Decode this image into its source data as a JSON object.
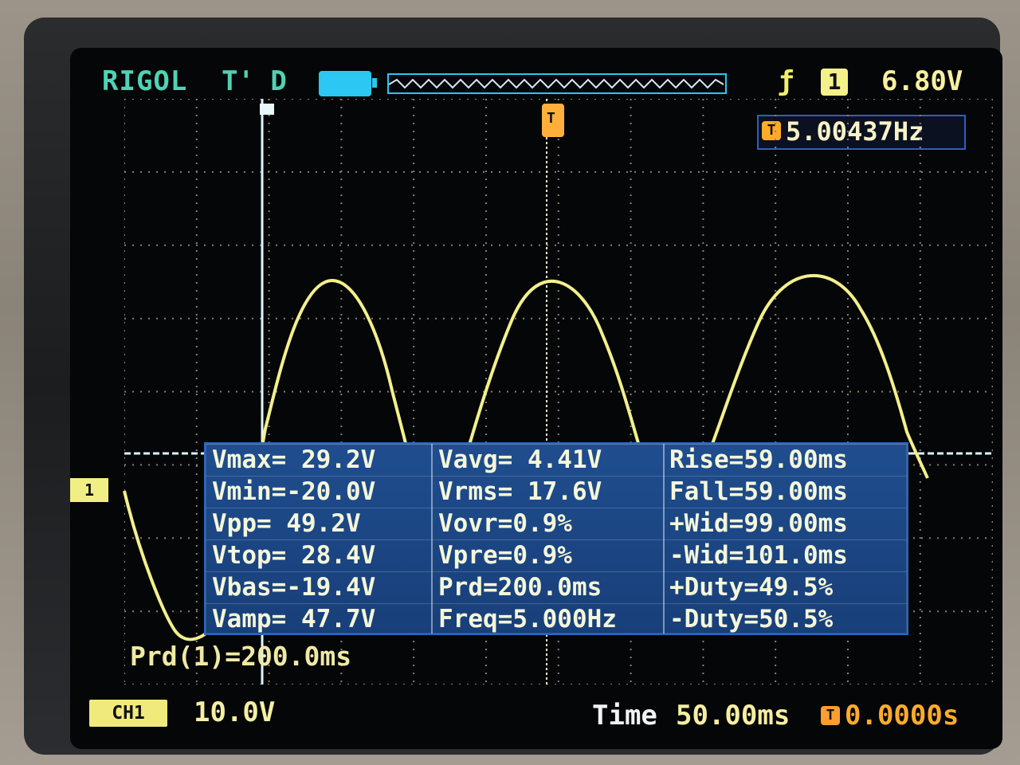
{
  "top_bar": {
    "brand": "RIGOL",
    "status": "T' D",
    "trigger_level": "6.80V",
    "channel": "1"
  },
  "frequency": {
    "value": "5.00437Hz"
  },
  "measurements": {
    "rows": [
      {
        "c1": "Vmax= 29.2V",
        "c2": "Vavg= 4.41V",
        "c3": "Rise=59.00ms"
      },
      {
        "c1": "Vmin=-20.0V",
        "c2": "Vrms= 17.6V",
        "c3": "Fall=59.00ms"
      },
      {
        "c1": "Vpp= 49.2V",
        "c2": "Vovr=0.9%",
        "c3": "+Wid=99.00ms"
      },
      {
        "c1": "Vtop= 28.4V",
        "c2": "Vpre=0.9%",
        "c3": "-Wid=101.0ms"
      },
      {
        "c1": "Vbas=-19.4V",
        "c2": "Prd=200.0ms",
        "c3": "+Duty=49.5%"
      },
      {
        "c1": "Vamp= 47.7V",
        "c2": "Freq=5.000Hz",
        "c3": "-Duty=50.5%"
      }
    ]
  },
  "readouts": {
    "period_cursor": "Prd(1)=200.0ms",
    "ch1_label": "CH1",
    "volts_div": "10.0V",
    "time_label": "Time",
    "time_value": "50.00ms",
    "trigger_position": "0.0000s"
  },
  "colors": {
    "brand": "#4fd2b5",
    "trace": "#f3f08b",
    "panel": "#1f4d8e",
    "trigger_orange": "#ffab2a"
  },
  "icons": {
    "battery": "battery-icon",
    "trigger_edge": "rising-edge-icon",
    "channel_badge": "channel-one-icon",
    "trigger_marker": "trigger-marker-icon"
  }
}
